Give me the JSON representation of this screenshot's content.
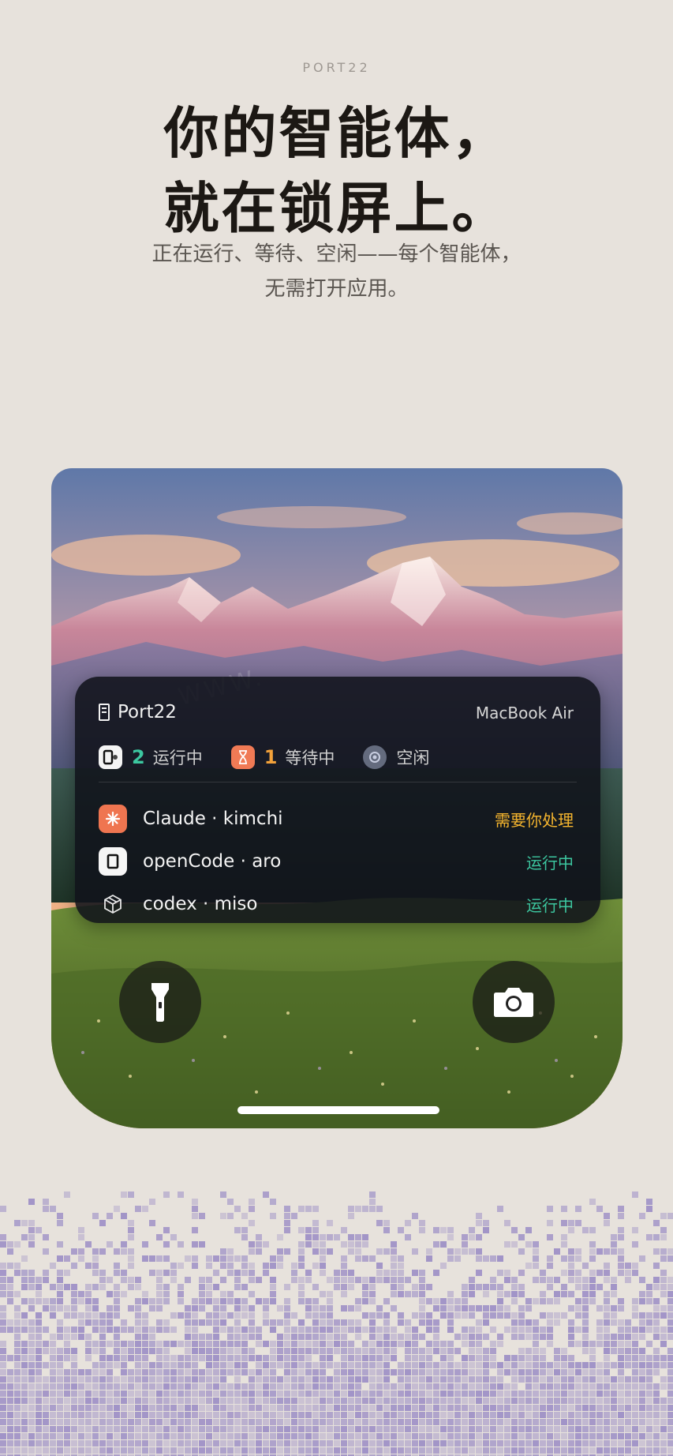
{
  "brand": "PORT22",
  "headline": {
    "line1": "你的智能体，",
    "line2": "就在锁屏上。"
  },
  "subtitle": {
    "line1": "正在运行、等待、空闲——每个智能体，",
    "line2": "无需打开应用。"
  },
  "lockscreen": {
    "watermark": "WWW.",
    "widget": {
      "app_name": "Port22",
      "device": "MacBook Air",
      "stats": [
        {
          "icon": "running-agent-icon",
          "count": "2",
          "label": "运行中",
          "color": "#3cc7a0"
        },
        {
          "icon": "hourglass-icon",
          "count": "1",
          "label": "等待中",
          "color": "#f2a13a"
        },
        {
          "icon": "idle-circle-icon",
          "count": "",
          "label": "空闲",
          "color": "#8a94aa"
        }
      ],
      "agents": [
        {
          "icon": "claude-sparkle-icon",
          "name": "Claude · kimchi",
          "status": "需要你处理",
          "status_color": "#f5b52e"
        },
        {
          "icon": "opencode-square-icon",
          "name": "openCode · aro",
          "status": "运行中",
          "status_color": "#3cc7a0"
        },
        {
          "icon": "codex-cube-icon",
          "name": "codex · miso",
          "status": "运行中",
          "status_color": "#3cc7a0"
        }
      ]
    },
    "buttons": {
      "left": "flashlight-icon",
      "right": "camera-icon"
    }
  },
  "colors": {
    "background": "#e7e2dc",
    "headline": "#1c1814",
    "pixel_pattern": "#9d8fc6"
  }
}
